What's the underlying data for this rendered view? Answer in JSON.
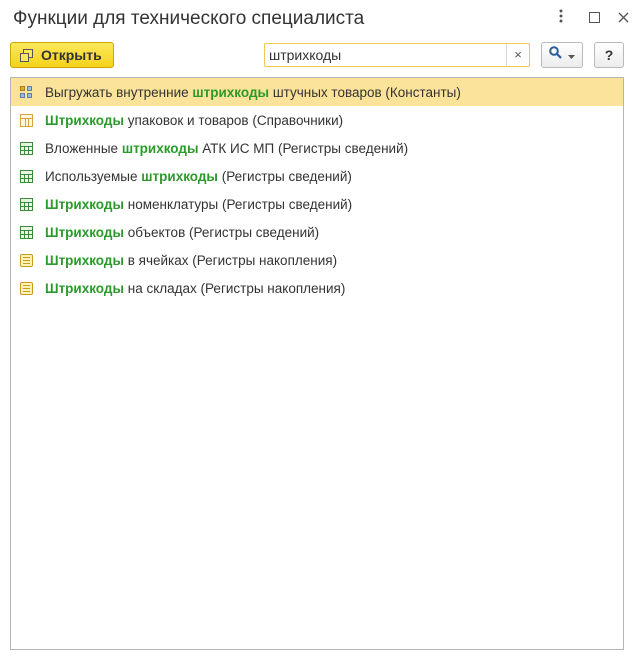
{
  "window": {
    "title": "Функции для технического специалиста",
    "menu_icon": "more-vertical-icon",
    "maximize_icon": "maximize-icon",
    "close_icon": "close-icon"
  },
  "toolbar": {
    "open_label": "Открыть",
    "search_value": "штрихкоды",
    "clear_glyph": "×",
    "help_label": "?"
  },
  "colors": {
    "accent_button": "#f5d31a",
    "selected_row": "#fbe39a",
    "highlight_text": "#2b9a2b"
  },
  "list": {
    "items": [
      {
        "icon": "constants-icon",
        "pre": "Выгружать внутренние ",
        "match": "штрихкоды",
        "post": " штучных товаров (Константы)",
        "selected": true
      },
      {
        "icon": "catalog-icon",
        "pre": "",
        "match": "Штрихкоды",
        "post": " упаковок и товаров (Справочники)",
        "selected": false
      },
      {
        "icon": "info-register-icon",
        "pre": "Вложенные ",
        "match": "штрихкоды",
        "post": " АТК ИС МП (Регистры сведений)",
        "selected": false
      },
      {
        "icon": "info-register-icon",
        "pre": "Используемые ",
        "match": "штрихкоды",
        "post": " (Регистры сведений)",
        "selected": false
      },
      {
        "icon": "info-register-icon",
        "pre": "",
        "match": "Штрихкоды",
        "post": " номенклатуры (Регистры сведений)",
        "selected": false
      },
      {
        "icon": "info-register-icon",
        "pre": "",
        "match": "Штрихкоды",
        "post": " объектов (Регистры сведений)",
        "selected": false
      },
      {
        "icon": "accumulation-register-icon",
        "pre": "",
        "match": "Штрихкоды",
        "post": " в ячейках (Регистры накопления)",
        "selected": false
      },
      {
        "icon": "accumulation-register-icon",
        "pre": "",
        "match": "Штрихкоды",
        "post": " на складах (Регистры накопления)",
        "selected": false
      }
    ]
  }
}
